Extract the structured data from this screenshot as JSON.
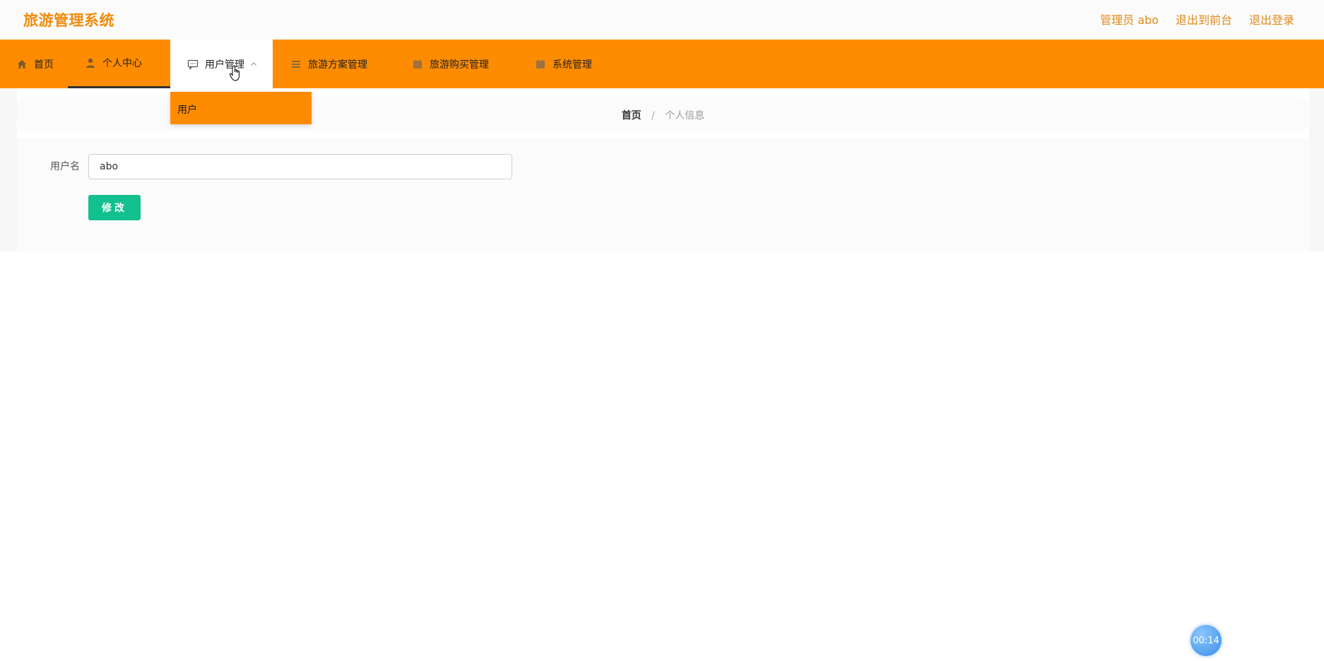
{
  "header": {
    "app_title": "旅游管理系统",
    "admin_label": "管理员 abo",
    "exit_frontend": "退出到前台",
    "logout": "退出登录"
  },
  "nav": {
    "home": "首页",
    "personal_center": "个人中心",
    "user_management": "用户管理",
    "travel_plan_management": "旅游方案管理",
    "travel_purchase_management": "旅游购买管理",
    "system_management": "系统管理"
  },
  "dropdown": {
    "items": [
      "用户"
    ]
  },
  "breadcrumb": {
    "home": "首页",
    "separator": "/",
    "current": "个人信息"
  },
  "form": {
    "username_label": "用户名",
    "username_value": "abo",
    "submit_label": "修改"
  },
  "timer": {
    "value": "00:14"
  },
  "colors": {
    "brand_orange": "#ff8c00",
    "title_orange": "#f28b0c",
    "submit_green": "#13c08f",
    "timer_blue": "#3a8fe6"
  }
}
